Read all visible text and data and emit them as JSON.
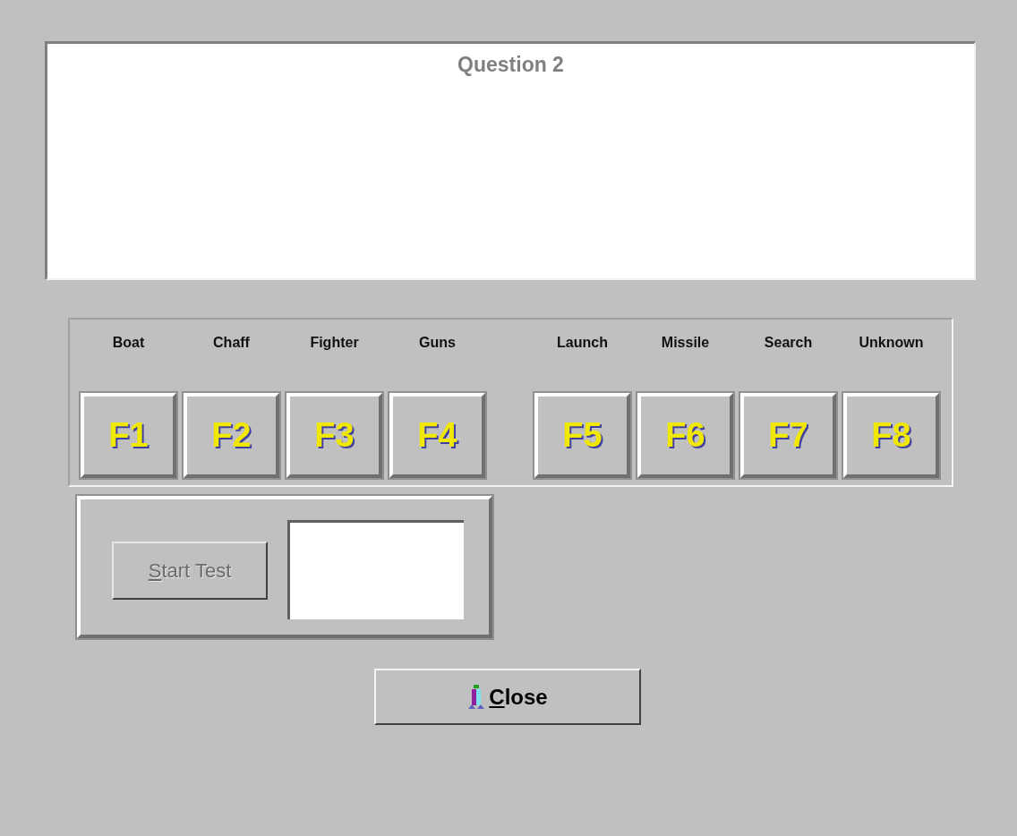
{
  "question": {
    "title": "Question 2"
  },
  "key_groups": [
    {
      "keys": [
        {
          "label": "Boat",
          "key": "F1"
        },
        {
          "label": "Chaff",
          "key": "F2"
        },
        {
          "label": "Fighter",
          "key": "F3"
        },
        {
          "label": "Guns",
          "key": "F4"
        }
      ]
    },
    {
      "keys": [
        {
          "label": "Launch",
          "key": "F5"
        },
        {
          "label": "Missile",
          "key": "F6"
        },
        {
          "label": "Search",
          "key": "F7"
        },
        {
          "label": "Unknown",
          "key": "F8"
        }
      ]
    }
  ],
  "start_button": {
    "label": "Start Test",
    "first_letter_underlined": true,
    "disabled": true
  },
  "close_button": {
    "label": "Close",
    "first_letter_underlined": true
  }
}
